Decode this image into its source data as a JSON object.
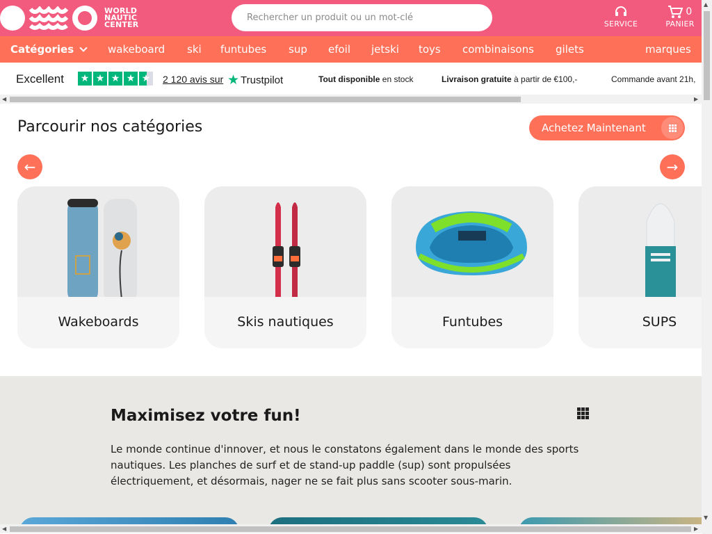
{
  "header": {
    "logo_text_line1": "WORLD",
    "logo_text_line2": "NAUTIC",
    "logo_text_line3": "CENTER",
    "search_placeholder": "Rechercher un produit ou un mot-clé",
    "service_label": "SERVICE",
    "cart_label": "PANIER",
    "cart_count": "0",
    "icons": {
      "service": "headset-icon",
      "cart": "cart-icon"
    },
    "colors": {
      "header_bg": "#f25a7e",
      "nav_bg": "#ff7058"
    }
  },
  "nav": {
    "categories_label": "Catégories",
    "items": [
      "wakeboard",
      "ski",
      "funtubes",
      "sup",
      "efoil",
      "jetski",
      "toys",
      "combinaisons",
      "gilets"
    ],
    "brands_label": "marques"
  },
  "trust": {
    "rating_word": "Excellent",
    "reviews_text": "2 120 avis sur",
    "provider": "Trustpilot",
    "usps": [
      {
        "bold": "Tout disponible",
        "rest": "en stock"
      },
      {
        "bold": "Livraison gratuite",
        "rest": "à partir de €100,-"
      },
      {
        "bold": "",
        "rest": "Commande avant 21h,"
      }
    ]
  },
  "categories": {
    "title": "Parcourir nos catégories",
    "buy_button": "Achetez Maintenant",
    "cards": [
      {
        "label": "Wakeboards"
      },
      {
        "label": "Skis nautiques"
      },
      {
        "label": "Funtubes"
      },
      {
        "label": "SUPS"
      }
    ]
  },
  "fun": {
    "title": "Maximisez votre fun!",
    "body": "Le monde continue d'innover, et nous le constatons également dans le monde des sports nautiques. Les planches de surf et de stand-up paddle (sup) sont propulsées électriquement, et désormais, nager ne se fait plus sans scooter sous-marin."
  }
}
